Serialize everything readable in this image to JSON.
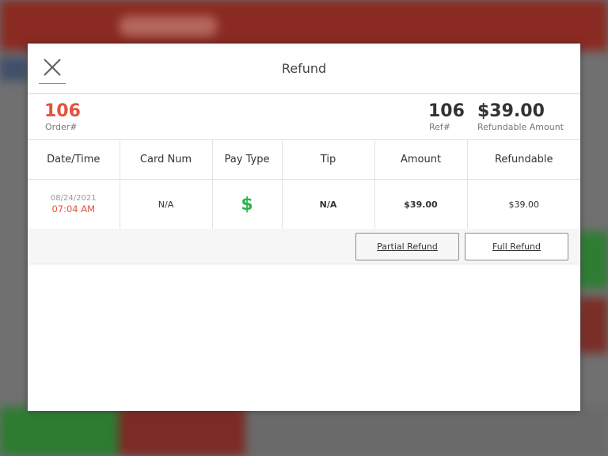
{
  "modal": {
    "title": "Refund",
    "close_icon": "close-icon"
  },
  "summary": {
    "order_number": "106",
    "order_label": "Order#",
    "ref_number": "106",
    "ref_label": "Ref#",
    "refundable_amount": "$39.00",
    "refundable_label": "Refundable Amount"
  },
  "table": {
    "headers": [
      "Date/Time",
      "Card Num",
      "Pay Type",
      "Tip",
      "Amount",
      "Refundable"
    ],
    "rows": [
      {
        "date": "08/24/2021",
        "time": "07:04 AM",
        "card_num": "N/A",
        "pay_type_icon": "dollar-icon",
        "pay_type_glyph": "$",
        "tip": "N/A",
        "amount": "$39.00",
        "refundable": "$39.00"
      }
    ]
  },
  "actions": {
    "partial_refund": "Partial Refund",
    "full_refund": "Full Refund"
  },
  "colors": {
    "accent_red": "#e35240",
    "cash_green": "#2bb44a"
  }
}
